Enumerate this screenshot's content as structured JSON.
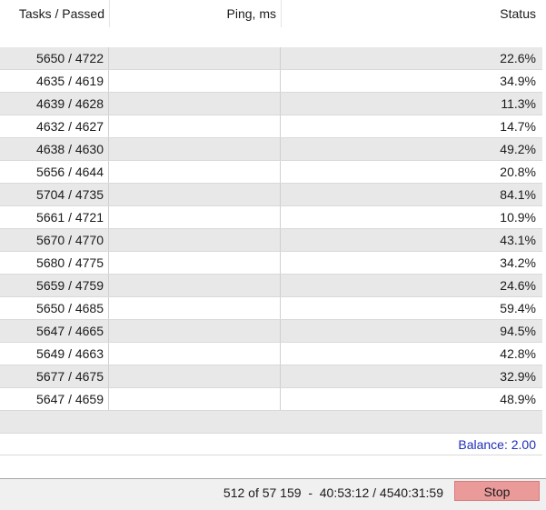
{
  "header": {
    "col1": "Tasks / Passed",
    "col2": "Ping, ms",
    "col3": "Status"
  },
  "rows": [
    {
      "tasks": "5650 / 4722",
      "ping": "",
      "status": "22.6%"
    },
    {
      "tasks": "4635 / 4619",
      "ping": "",
      "status": "34.9%"
    },
    {
      "tasks": "4639 / 4628",
      "ping": "",
      "status": "11.3%"
    },
    {
      "tasks": "4632 / 4627",
      "ping": "",
      "status": "14.7%"
    },
    {
      "tasks": "4638 / 4630",
      "ping": "",
      "status": "49.2%"
    },
    {
      "tasks": "5656 / 4644",
      "ping": "",
      "status": "20.8%"
    },
    {
      "tasks": "5704 / 4735",
      "ping": "",
      "status": "84.1%"
    },
    {
      "tasks": "5661 / 4721",
      "ping": "",
      "status": "10.9%"
    },
    {
      "tasks": "5670 / 4770",
      "ping": "",
      "status": "43.1%"
    },
    {
      "tasks": "5680 / 4775",
      "ping": "",
      "status": "34.2%"
    },
    {
      "tasks": "5659 / 4759",
      "ping": "",
      "status": "24.6%"
    },
    {
      "tasks": "5650 / 4685",
      "ping": "",
      "status": "59.4%"
    },
    {
      "tasks": "5647 / 4665",
      "ping": "",
      "status": "94.5%"
    },
    {
      "tasks": "5649 / 4663",
      "ping": "",
      "status": "42.8%"
    },
    {
      "tasks": "5677 / 4675",
      "ping": "",
      "status": "32.9%"
    },
    {
      "tasks": "5647 / 4659",
      "ping": "",
      "status": "48.9%"
    }
  ],
  "balance": "Balance: 2.00",
  "footer": {
    "progress_text": "512 of 57 159  -  40:53:12 / 4540:31:59",
    "stop_label": "Stop"
  },
  "colors": {
    "balance_text": "#1f2fb8",
    "stop_button_bg": "#eb9a9a",
    "row_alt_bg": "#e8e8e8"
  }
}
